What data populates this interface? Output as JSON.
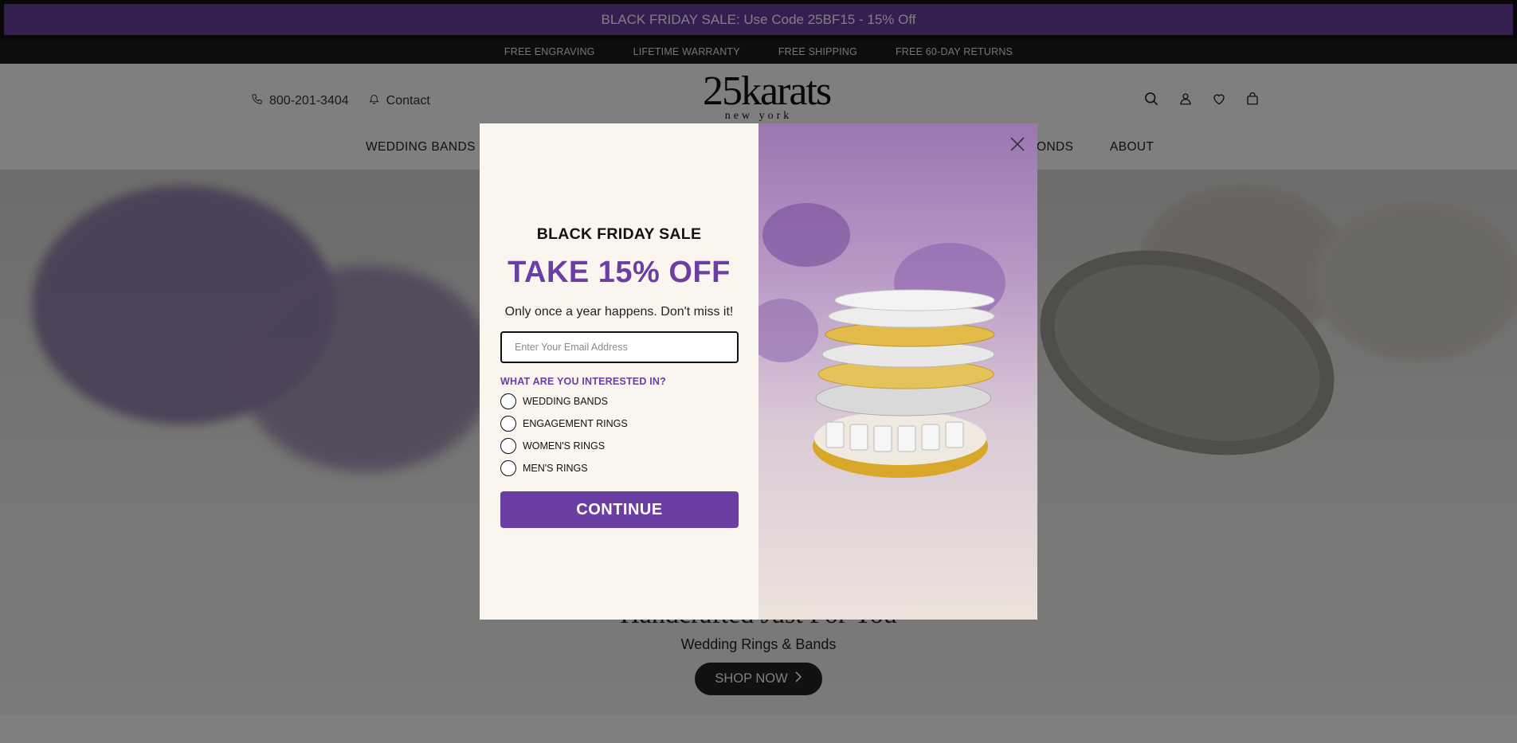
{
  "promo": {
    "text": "BLACK FRIDAY SALE: Use Code 25BF15 - 15% Off"
  },
  "usps": [
    "FREE ENGRAVING",
    "LIFETIME WARRANTY",
    "FREE SHIPPING",
    "FREE 60-DAY RETURNS"
  ],
  "header": {
    "phone": "800-201-3404",
    "contact": "Contact",
    "logo_main": "25karats",
    "logo_sub": "new york"
  },
  "nav": {
    "items": [
      "WEDDING BANDS",
      "ONDS",
      "ABOUT"
    ]
  },
  "hero": {
    "title": "Handcrafted Just For You",
    "subtitle": "Wedding Rings & Bands",
    "shop_now": "SHOP NOW"
  },
  "modal": {
    "eyebrow": "BLACK FRIDAY SALE",
    "headline": "TAKE 15% OFF",
    "description": "Only once a year happens. Don't miss it!",
    "email_placeholder": "Enter Your Email Address",
    "question": "WHAT ARE YOU INTERESTED IN?",
    "options": [
      "WEDDING BANDS",
      "ENGAGEMENT RINGS",
      "WOMEN'S RINGS",
      "MEN'S RINGS"
    ],
    "continue": "CONTINUE"
  },
  "colors": {
    "accent": "#6a3ea3",
    "dark": "#111111"
  }
}
